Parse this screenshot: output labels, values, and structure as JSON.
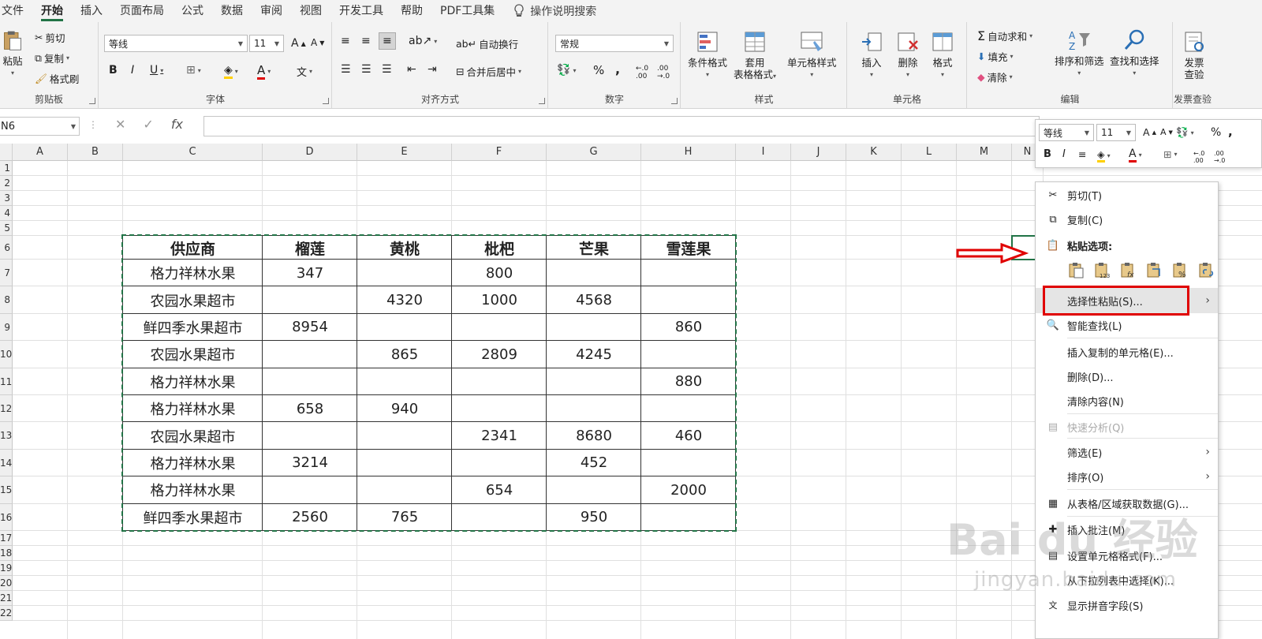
{
  "menubar": {
    "tabs": [
      "文件",
      "开始",
      "插入",
      "页面布局",
      "公式",
      "数据",
      "审阅",
      "视图",
      "开发工具",
      "帮助",
      "PDF工具集"
    ],
    "active_index": 1,
    "tell_me": "操作说明搜索"
  },
  "ribbon": {
    "clipboard": {
      "paste": "粘贴",
      "cut": "剪切",
      "copy": "复制",
      "format_painter": "格式刷",
      "label": "剪贴板"
    },
    "font": {
      "name": "等线",
      "size": "11",
      "label": "字体"
    },
    "alignment": {
      "wrap": "自动换行",
      "merge": "合并后居中",
      "label": "对齐方式"
    },
    "number": {
      "format": "常规",
      "label": "数字"
    },
    "styles": {
      "cond": "条件格式",
      "table": "套用",
      "table2": "表格格式",
      "cell_styles": "单元格样式",
      "label": "样式"
    },
    "cells": {
      "insert": "插入",
      "delete": "删除",
      "format": "格式",
      "label": "单元格"
    },
    "editing": {
      "autosum": "自动求和",
      "fill": "填充",
      "clear": "清除",
      "sort": "排序和筛选",
      "find": "查找和选择",
      "label": "编辑"
    },
    "invoice": {
      "btn1": "发票",
      "btn2": "查验",
      "label": "发票查验"
    }
  },
  "formula_bar": {
    "name_box": "N6",
    "value": ""
  },
  "columns": [
    "A",
    "B",
    "C",
    "D",
    "E",
    "F",
    "G",
    "H",
    "I",
    "J",
    "K",
    "L",
    "M",
    "N"
  ],
  "rows": [
    "1",
    "2",
    "3",
    "4",
    "5",
    "6",
    "7",
    "8",
    "9",
    "10",
    "11",
    "12",
    "13",
    "14",
    "15",
    "16",
    "17",
    "18",
    "19",
    "20",
    "21",
    "22"
  ],
  "table": {
    "headers": [
      "供应商",
      "榴莲",
      "黄桃",
      "枇杷",
      "芒果",
      "雪莲果"
    ],
    "rows": [
      [
        "格力祥林水果",
        "347",
        "",
        "800",
        "",
        ""
      ],
      [
        "农园水果超市",
        "",
        "4320",
        "1000",
        "4568",
        ""
      ],
      [
        "鲜四季水果超市",
        "8954",
        "",
        "",
        "",
        "860"
      ],
      [
        "农园水果超市",
        "",
        "865",
        "2809",
        "4245",
        ""
      ],
      [
        "格力祥林水果",
        "",
        "",
        "",
        "",
        "880"
      ],
      [
        "格力祥林水果",
        "658",
        "940",
        "",
        "",
        ""
      ],
      [
        "农园水果超市",
        "",
        "",
        "2341",
        "8680",
        "460"
      ],
      [
        "格力祥林水果",
        "3214",
        "",
        "",
        "452",
        ""
      ],
      [
        "格力祥林水果",
        "",
        "",
        "654",
        "",
        "2000"
      ],
      [
        "鲜四季水果超市",
        "2560",
        "765",
        "",
        "950",
        ""
      ]
    ]
  },
  "mini_toolbar": {
    "font": "等线",
    "size": "11"
  },
  "context_menu": {
    "cut": "剪切(T)",
    "copy": "复制(C)",
    "paste_options": "粘贴选项:",
    "paste_special": "选择性粘贴(S)...",
    "smart_lookup": "智能查找(L)",
    "insert_copied": "插入复制的单元格(E)...",
    "delete": "删除(D)...",
    "clear": "清除内容(N)",
    "quick_analysis": "快速分析(Q)",
    "filter": "筛选(E)",
    "sort": "排序(O)",
    "get_data": "从表格/区域获取数据(G)...",
    "insert_comment": "插入批注(M)",
    "format_cells": "设置单元格格式(F)...",
    "pick_list": "从下拉列表中选择(K)...",
    "phonetic": "显示拼音字段(S)"
  },
  "watermark": {
    "brand": "Bai du 经验",
    "url": "jingyan.baidu.com"
  },
  "colors": {
    "accent": "#217346",
    "highlight": "#e00000"
  }
}
